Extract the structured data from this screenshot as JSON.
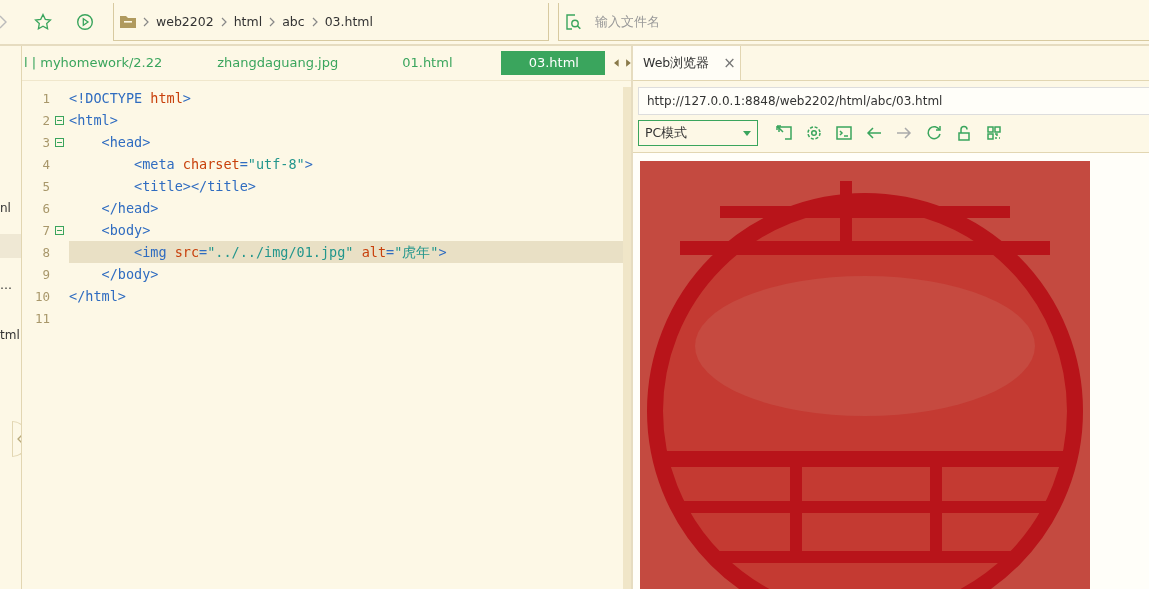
{
  "toolbar": {
    "breadcrumb": [
      "web2202",
      "html",
      "abc",
      "03.html"
    ],
    "search": {
      "placeholder": "输入文件名"
    }
  },
  "sidebar": {
    "items": [
      {
        "label": "nl",
        "selected": false
      },
      {
        "selected": true
      },
      {
        "label": "…",
        "selected": false
      },
      {
        "label": "tml",
        "selected": false
      }
    ]
  },
  "editor_tabs": [
    {
      "label": "l | myhomework/2.22",
      "selected": false
    },
    {
      "label": "zhangdaguang.jpg",
      "selected": false
    },
    {
      "label": "01.html",
      "selected": false
    },
    {
      "label": "03.html",
      "selected": true
    }
  ],
  "code": [
    {
      "number": "1",
      "fold": false,
      "current": false,
      "tokens": [
        {
          "kind": "tag",
          "text": "<!DOCTYPE "
        },
        {
          "kind": "attr",
          "text": "html"
        },
        {
          "kind": "tag",
          "text": ">"
        }
      ]
    },
    {
      "number": "2",
      "fold": true,
      "current": false,
      "tokens": [
        {
          "kind": "tag",
          "text": "<html>"
        }
      ]
    },
    {
      "number": "3",
      "fold": true,
      "current": false,
      "tokens": [
        {
          "kind": "tag",
          "text": "    <head>"
        }
      ]
    },
    {
      "number": "4",
      "fold": false,
      "current": false,
      "tokens": [
        {
          "kind": "tag",
          "text": "        <meta "
        },
        {
          "kind": "attr",
          "text": "charset"
        },
        {
          "kind": "tag",
          "text": "="
        },
        {
          "kind": "str",
          "text": "\"utf-8\""
        },
        {
          "kind": "tag",
          "text": ">"
        }
      ]
    },
    {
      "number": "5",
      "fold": false,
      "current": false,
      "tokens": [
        {
          "kind": "tag",
          "text": "        <title></title>"
        }
      ]
    },
    {
      "number": "6",
      "fold": false,
      "current": false,
      "tokens": [
        {
          "kind": "tag",
          "text": "    </head>"
        }
      ]
    },
    {
      "number": "7",
      "fold": true,
      "current": false,
      "tokens": [
        {
          "kind": "tag",
          "text": "    <body>"
        }
      ]
    },
    {
      "number": "8",
      "fold": false,
      "current": true,
      "tokens": [
        {
          "kind": "tag",
          "text": "        <img "
        },
        {
          "kind": "attr",
          "text": "src"
        },
        {
          "kind": "tag",
          "text": "="
        },
        {
          "kind": "str",
          "text": "\"../../img/01.jpg\""
        },
        {
          "kind": "attr",
          "text": " alt"
        },
        {
          "kind": "tag",
          "text": "="
        },
        {
          "kind": "str",
          "text": "\"虎年\""
        },
        {
          "kind": "tag",
          "text": ">"
        }
      ]
    },
    {
      "number": "9",
      "fold": false,
      "current": false,
      "tokens": [
        {
          "kind": "tag",
          "text": "    </body>"
        }
      ]
    },
    {
      "number": "10",
      "fold": false,
      "current": false,
      "tokens": [
        {
          "kind": "tag",
          "text": "</html>"
        }
      ]
    },
    {
      "number": "11",
      "fold": false,
      "current": false
    }
  ],
  "browser": {
    "tab": {
      "label": "Web浏览器",
      "close": "×"
    },
    "address": "http://127.0.0.1:8848/web2202/html/abc/03.html",
    "mode": "PC模式",
    "tools": [
      {
        "kind": "expand",
        "disabled": false
      },
      {
        "kind": "gear",
        "disabled": false
      },
      {
        "kind": "terminal",
        "disabled": false
      },
      {
        "kind": "back",
        "disabled": false
      },
      {
        "kind": "forward",
        "disabled": true
      },
      {
        "kind": "reload",
        "disabled": false
      },
      {
        "kind": "lock",
        "disabled": false
      },
      {
        "kind": "grid",
        "disabled": false
      }
    ]
  }
}
